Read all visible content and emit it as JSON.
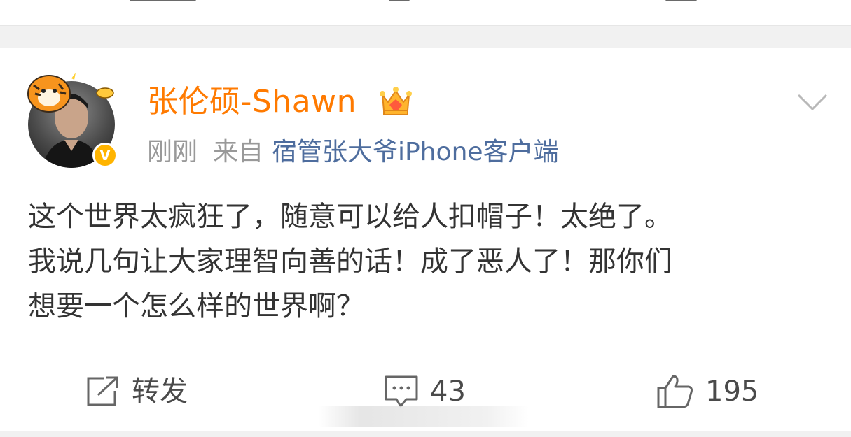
{
  "post": {
    "author": "张伦硕-Shawn",
    "time": "刚刚",
    "source_prefix": "来自",
    "source_client": "宿管张大爷iPhone客户端",
    "verified_badge": "V",
    "content_lines": [
      "这个世界太疯狂了，随意可以给人扣帽子！太绝了。",
      "我说几句让大家理智向善的话！成了恶人了！那你们",
      "想要一个怎么样的世界啊？"
    ]
  },
  "actions": {
    "repost_label": "转发",
    "comment_count": "43",
    "like_count": "195"
  },
  "icons": {
    "crown": "crown-vip-icon",
    "verified": "verified-badge-icon",
    "more": "chevron-down-icon",
    "repost": "repost-icon",
    "comment": "comment-icon",
    "like": "thumbs-up-icon"
  },
  "colors": {
    "username": "#ff7a00",
    "client_link": "#4e6d9e",
    "meta_gray": "#999999",
    "text": "#333333",
    "verified": "#ffb400",
    "page_bg": "#f1f1f1"
  }
}
